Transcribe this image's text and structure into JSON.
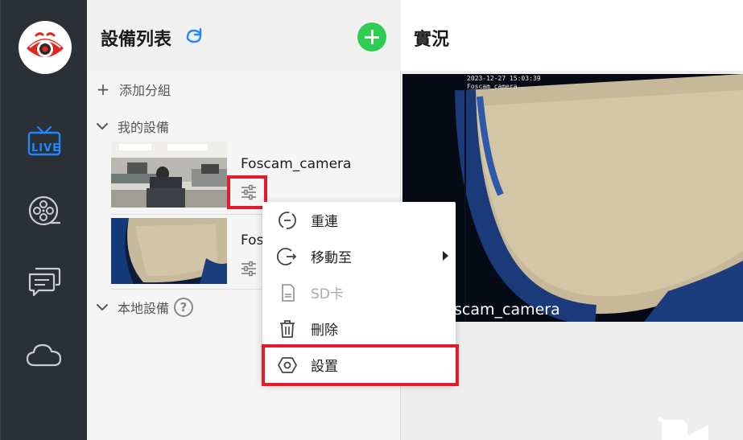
{
  "sidebar": {
    "logo_icon": "eye-logo-icon",
    "items": [
      {
        "name": "live",
        "label": "LIVE",
        "icon": "live-tv-icon",
        "active": true,
        "color": "#1e88ff"
      },
      {
        "name": "playback",
        "icon": "film-reel-icon"
      },
      {
        "name": "messages",
        "icon": "chat-icon"
      },
      {
        "name": "cloud",
        "icon": "cloud-icon"
      }
    ]
  },
  "device_panel": {
    "title": "設備列表",
    "refresh_icon": "refresh-icon",
    "add_icon": "plus-circle-icon",
    "add_group_label": "添加分組",
    "groups": [
      {
        "label": "我的設備",
        "expanded": true,
        "devices": [
          {
            "name": "Foscam_camera"
          },
          {
            "name": "Foscam_camera",
            "truncated_label": "Fos"
          }
        ]
      },
      {
        "label": "本地設備",
        "expanded": true,
        "help": "?"
      }
    ]
  },
  "live_view": {
    "title": "實況",
    "osd_timestamp": "2023-12-27 15:03:39",
    "osd_name": "Foscam_camera",
    "camera_label": "scam_camera"
  },
  "context_menu": {
    "items": [
      {
        "label": "重連",
        "icon": "reconnect-icon",
        "disabled": false
      },
      {
        "label": "移動至",
        "icon": "move-to-icon",
        "disabled": false,
        "has_submenu": true
      },
      {
        "label": "SD卡",
        "icon": "sd-card-icon",
        "disabled": true
      },
      {
        "label": "刪除",
        "icon": "trash-icon",
        "disabled": false
      },
      {
        "label": "設置",
        "icon": "hexagon-settings-icon",
        "disabled": false,
        "highlighted": true
      }
    ]
  },
  "colors": {
    "accent": "#1e88ff",
    "add_button": "#2ecc52",
    "highlight_box": "#e11d2b",
    "sidebar_bg": "#2b3037"
  }
}
